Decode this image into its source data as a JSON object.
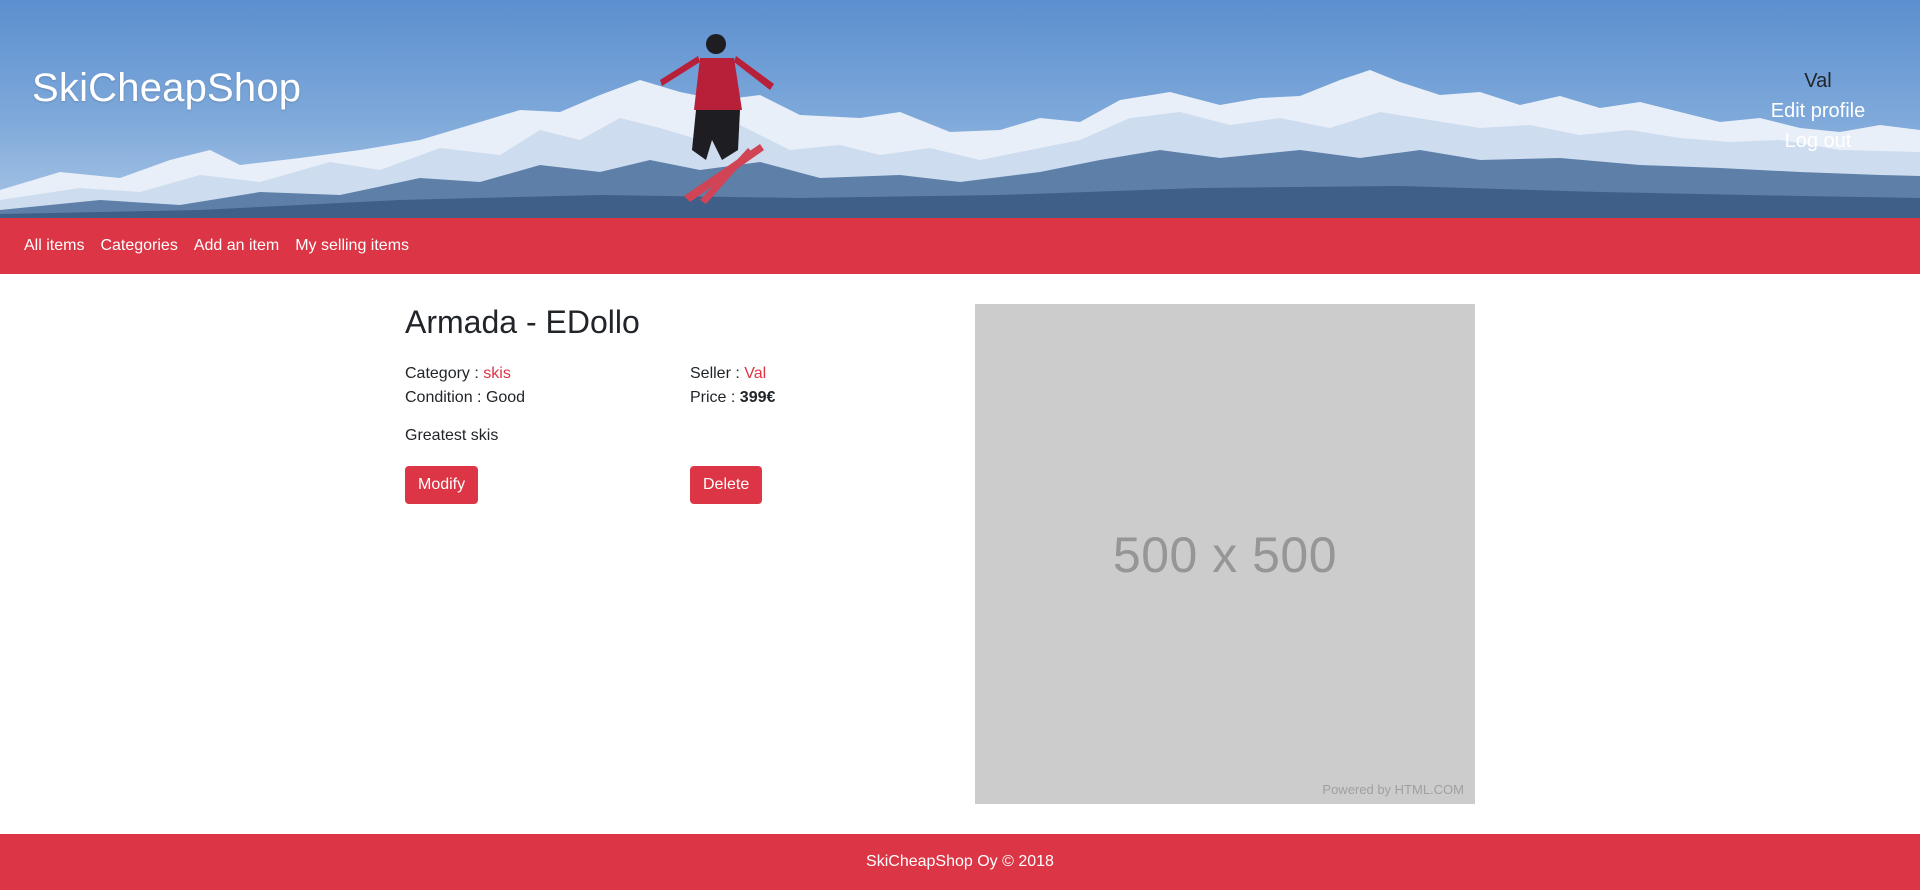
{
  "header": {
    "site_title": "SkiCheapShop",
    "user": {
      "name": "Val",
      "edit_profile": "Edit profile",
      "log_out": "Log out"
    }
  },
  "nav": {
    "items": [
      {
        "label": "All items"
      },
      {
        "label": "Categories"
      },
      {
        "label": "Add an item"
      },
      {
        "label": "My selling items"
      }
    ]
  },
  "item": {
    "title": "Armada - EDollo",
    "category_label": "Category : ",
    "category_value": "skis",
    "condition_label": "Condition : ",
    "condition_value": "Good",
    "seller_label": "Seller : ",
    "seller_value": "Val",
    "price_label": "Price : ",
    "price_value": "399€",
    "description": "Greatest skis",
    "modify_label": "Modify",
    "delete_label": "Delete"
  },
  "image_placeholder": {
    "dimensions_text": "500 x 500",
    "powered_by": "Powered by HTML.COM"
  },
  "footer": {
    "text": "SkiCheapShop Oy © 2018"
  },
  "colors": {
    "accent": "#dc3545",
    "text": "#212529",
    "placeholder_bg": "#cccccc"
  }
}
